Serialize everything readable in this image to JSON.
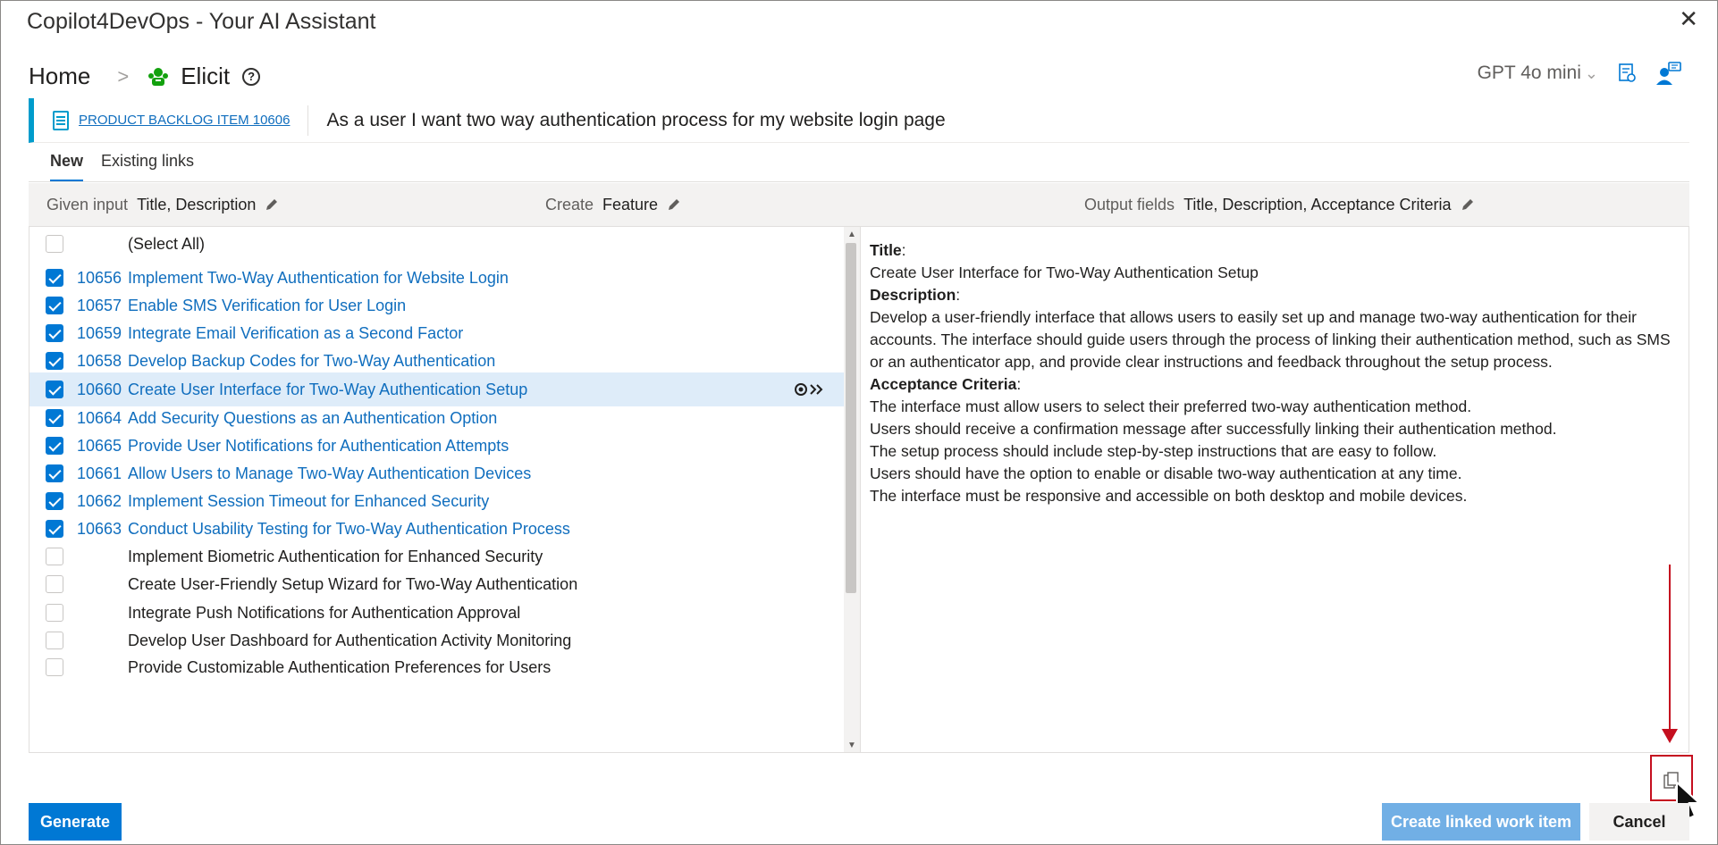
{
  "window": {
    "title": "Copilot4DevOps - Your AI Assistant"
  },
  "breadcrumb": {
    "home": "Home",
    "separator": ">",
    "current": "Elicit",
    "help": "?"
  },
  "header": {
    "model": "GPT 4o mini"
  },
  "work_item": {
    "link": "PRODUCT BACKLOG ITEM 10606",
    "title": "As a user I want two way authentication process for my website login page"
  },
  "tabs": [
    {
      "label": "New",
      "active": true
    },
    {
      "label": "Existing links",
      "active": false
    }
  ],
  "input_bar": {
    "given_input_label": "Given input",
    "given_input_value": "Title,  Description",
    "create_label": "Create",
    "create_value": "Feature",
    "output_label": "Output fields",
    "output_value": "Title,  Description,  Acceptance Criteria"
  },
  "list": {
    "select_all": "(Select All)",
    "items": [
      {
        "id": "10656",
        "title": "Implement Two-Way Authentication for Website Login",
        "checked": true,
        "selected": false
      },
      {
        "id": "10657",
        "title": "Enable SMS Verification for User Login",
        "checked": true,
        "selected": false
      },
      {
        "id": "10659",
        "title": "Integrate Email Verification as a Second Factor",
        "checked": true,
        "selected": false
      },
      {
        "id": "10658",
        "title": "Develop Backup Codes for Two-Way Authentication",
        "checked": true,
        "selected": false
      },
      {
        "id": "10660",
        "title": "Create User Interface for Two-Way Authentication Setup",
        "checked": true,
        "selected": true
      },
      {
        "id": "10664",
        "title": "Add Security Questions as an Authentication Option",
        "checked": true,
        "selected": false
      },
      {
        "id": "10665",
        "title": "Provide User Notifications for Authentication Attempts",
        "checked": true,
        "selected": false
      },
      {
        "id": "10661",
        "title": "Allow Users to Manage Two-Way Authentication Devices",
        "checked": true,
        "selected": false
      },
      {
        "id": "10662",
        "title": "Implement Session Timeout for Enhanced Security",
        "checked": true,
        "selected": false
      },
      {
        "id": "10663",
        "title": "Conduct Usability Testing for Two-Way Authentication Process",
        "checked": true,
        "selected": false
      },
      {
        "id": "",
        "title": "Implement Biometric Authentication for Enhanced Security",
        "checked": false,
        "selected": false
      },
      {
        "id": "",
        "title": "Create User-Friendly Setup Wizard for Two-Way Authentication",
        "checked": false,
        "selected": false
      },
      {
        "id": "",
        "title": "Integrate Push Notifications for Authentication Approval",
        "checked": false,
        "selected": false
      },
      {
        "id": "",
        "title": "Develop User Dashboard for Authentication Activity Monitoring",
        "checked": false,
        "selected": false
      },
      {
        "id": "",
        "title": "Provide Customizable Authentication Preferences for Users",
        "checked": false,
        "selected": false
      }
    ]
  },
  "detail": {
    "title_label": "Title",
    "title_value": "Create User Interface for Two-Way Authentication Setup",
    "description_label": "Description",
    "description_value": "Develop a user-friendly interface that allows users to easily set up and manage two-way authentication for their accounts. The interface should guide users through the process of linking their authentication method, such as SMS or an authenticator app, and provide clear instructions and feedback throughout the setup process.",
    "acceptance_label": "Acceptance Criteria",
    "acceptance_lines": [
      "The interface must allow users to select their preferred two-way authentication method.",
      "Users should receive a confirmation message after successfully linking their authentication method.",
      "The setup process should include step-by-step instructions that are easy to follow.",
      "Users should have the option to enable or disable two-way authentication at any time.",
      "The interface must be responsive and accessible on both desktop and mobile devices."
    ]
  },
  "buttons": {
    "generate": "Generate",
    "create_linked": "Create linked work item",
    "cancel": "Cancel"
  },
  "colors": {
    "accent": "#0078d4",
    "link": "#106ebe",
    "selected_row": "#deecf9",
    "annotation": "#c50f1f",
    "wi_bar": "#009ccc"
  }
}
